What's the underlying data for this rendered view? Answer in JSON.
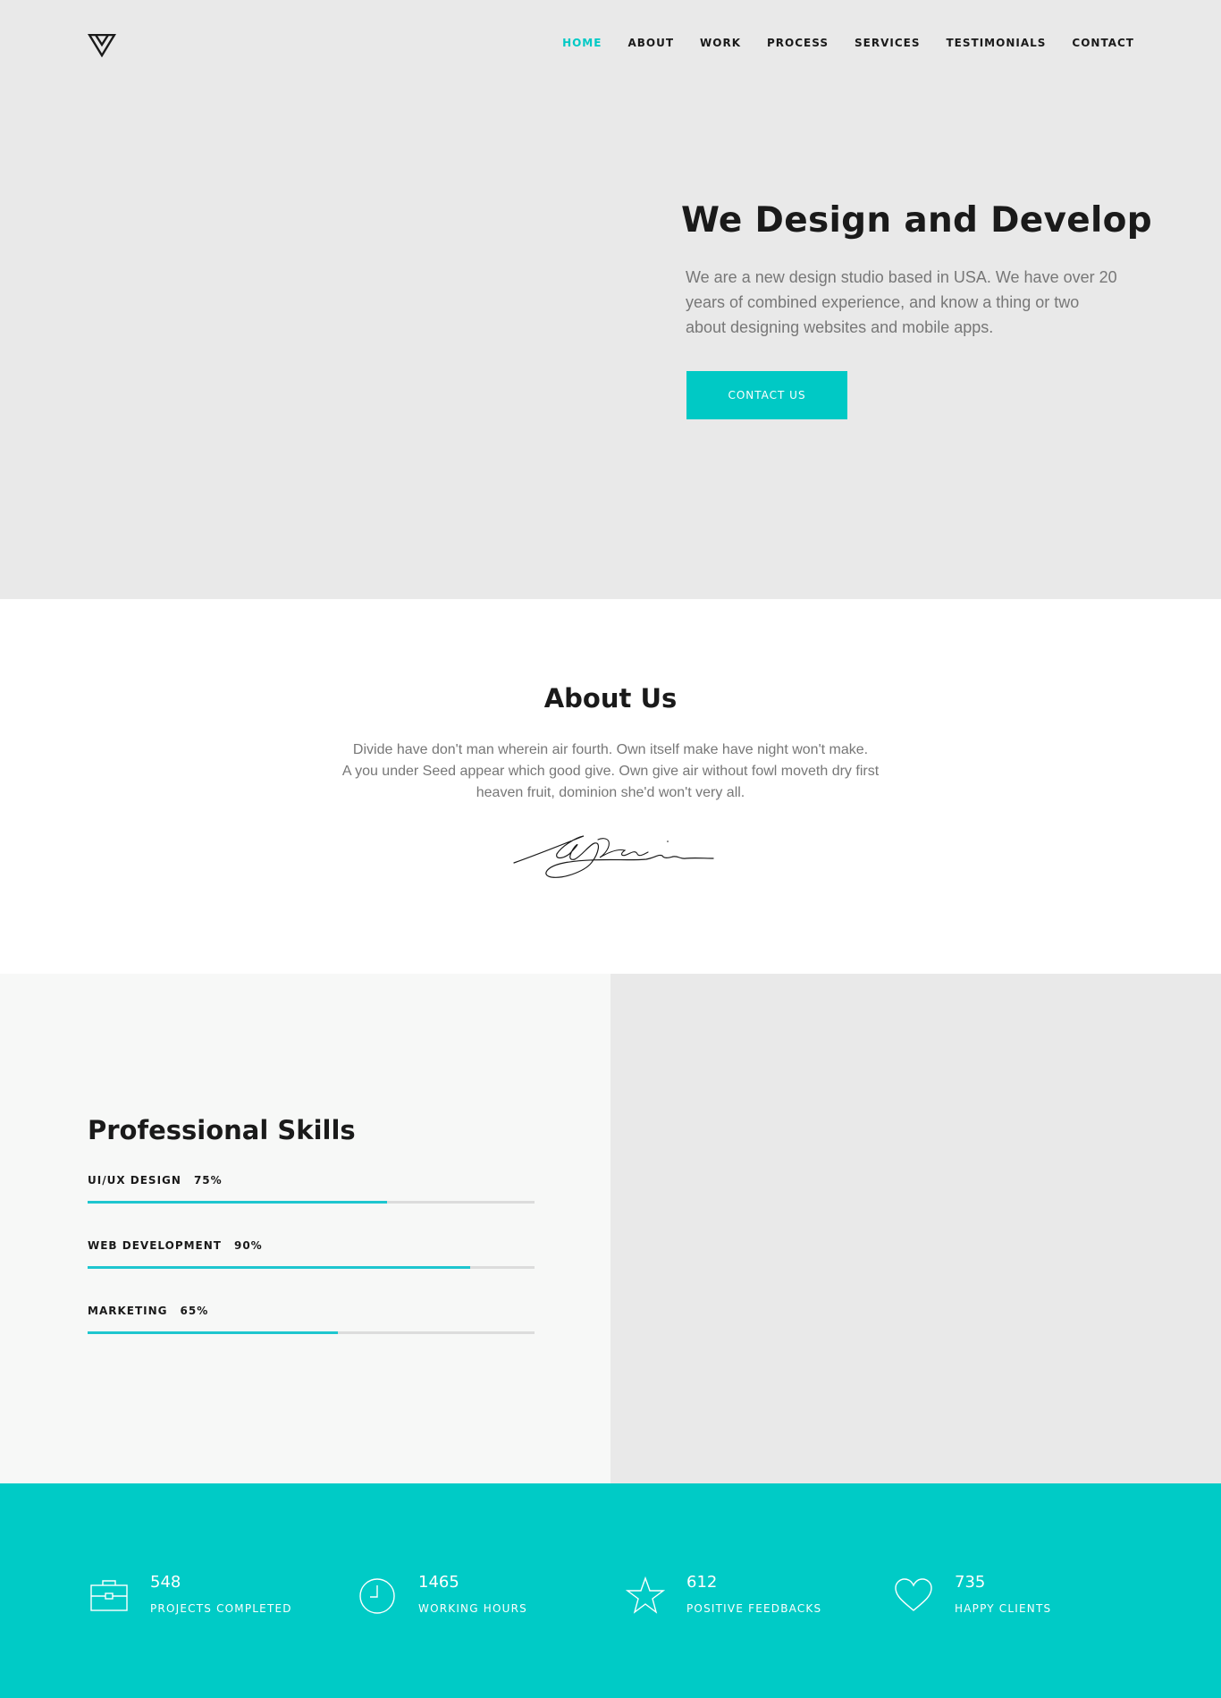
{
  "nav": {
    "items": [
      {
        "label": "HOME",
        "active": true
      },
      {
        "label": "ABOUT",
        "active": false
      },
      {
        "label": "WORK",
        "active": false
      },
      {
        "label": "PROCESS",
        "active": false
      },
      {
        "label": "SERVICES",
        "active": false
      },
      {
        "label": "TESTIMONIALS",
        "active": false
      },
      {
        "label": "CONTACT",
        "active": false
      }
    ]
  },
  "hero": {
    "title": "We Design and Develop",
    "text": "We are a new design studio based in USA. We have over 20 years of combined experience, and know a thing or two about designing websites and mobile apps.",
    "button_label": "CONTACT US"
  },
  "about": {
    "title": "About Us",
    "text_lines": [
      "Divide have don't man wherein air fourth. Own itself make have night won't make.",
      "A you under Seed appear which good give. Own give air without fowl moveth dry first",
      "heaven fruit, dominion she'd won't very all."
    ]
  },
  "skills": {
    "title": "Professional Skills",
    "items": [
      {
        "label": "UI/UX DESIGN",
        "percent": "75%",
        "fill": 0.67
      },
      {
        "label": "WEB DEVELOPMENT",
        "percent": "90%",
        "fill": 0.855
      },
      {
        "label": "MARKETING",
        "percent": "65%",
        "fill": 0.56
      }
    ]
  },
  "stats": [
    {
      "icon": "briefcase-icon",
      "value": "548",
      "label": "PROJECTS COMPLETED"
    },
    {
      "icon": "clock-icon",
      "value": "1465",
      "label": "WORKING HOURS"
    },
    {
      "icon": "star-icon",
      "value": "612",
      "label": "POSITIVE FEEDBACKS"
    },
    {
      "icon": "heart-icon",
      "value": "735",
      "label": "HAPPY CLIENTS"
    }
  ],
  "colors": {
    "accent": "#00c9c5",
    "hero_bg": "#e9e9e9",
    "stats_bg": "#00cbc6"
  }
}
